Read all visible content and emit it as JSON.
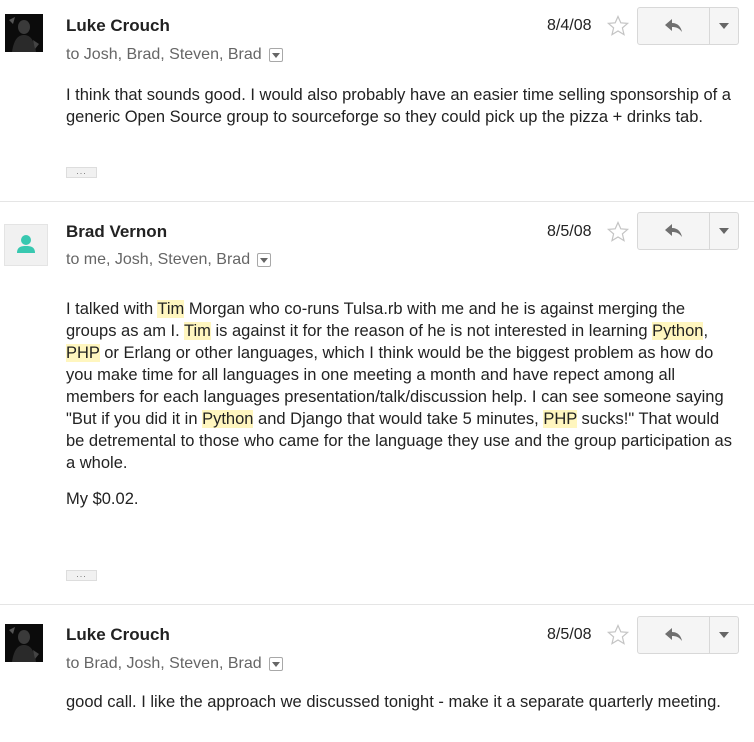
{
  "messages": [
    {
      "sender": "Luke Crouch",
      "date": "8/4/08",
      "recipients": "to Josh, Brad, Steven, Brad",
      "paragraphs": [
        "I think that sounds good. I would also probably have an easier time selling sponsorship of a generic Open Source group to sourceforge so they could pick up the pizza + drinks tab."
      ],
      "ellipsis": "..."
    },
    {
      "sender": "Brad Vernon",
      "date": "8/5/08",
      "recipients": "to me, Josh, Steven, Brad",
      "body": {
        "p1": [
          "I talked with ",
          "Tim",
          " Morgan who co-runs Tulsa.rb with me and he is against merging the groups as am I.  ",
          "Tim",
          " is against it for the reason of he is not interested in learning ",
          "Python",
          ", ",
          "PHP",
          " or Erlang or other languages, which I think would be the biggest problem as how do you make time for all languages in one meeting a month and have repect among all members for each languages presentation/talk/discussion help.  I can see someone saying \"But if you did it in ",
          "Python",
          " and Django that would take 5 minutes, ",
          "PHP",
          " sucks!\" That would be detremental to those who came for the language they use and the group participation as a whole."
        ],
        "p2": "My $0.02."
      },
      "ellipsis": "..."
    },
    {
      "sender": "Luke Crouch",
      "date": "8/5/08",
      "recipients": "to Brad, Josh, Steven, Brad",
      "paragraphs": [
        "good call. I like the approach we discussed tonight - make it a separate quarterly meeting."
      ]
    }
  ],
  "icons": {
    "star": "star-outline-icon",
    "reply": "reply-arrow-icon",
    "more": "caret-down-icon",
    "recipients_dropdown": "small-caret-down-icon"
  },
  "colors": {
    "highlight": "#fff6bf",
    "default_avatar": "#38c8b0",
    "divider": "#e5e5e5"
  }
}
